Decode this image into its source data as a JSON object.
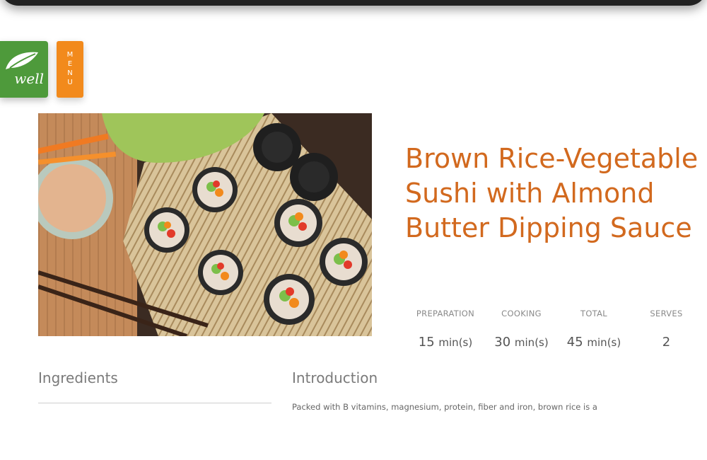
{
  "brand": {
    "logo_text": "well"
  },
  "menu": {
    "label": "MENU"
  },
  "recipe": {
    "title": "Brown Rice-Vegetable Sushi with Almond Butter Dipping Sauce",
    "stats": [
      {
        "label": "PREPARATION",
        "value": "15",
        "unit": "min(s)"
      },
      {
        "label": "COOKING",
        "value": "30",
        "unit": "min(s)"
      },
      {
        "label": "TOTAL",
        "value": "45",
        "unit": "min(s)"
      },
      {
        "label": "SERVES",
        "value": "2",
        "unit": ""
      }
    ]
  },
  "sections": {
    "ingredients_heading": "Ingredients",
    "introduction_heading": "Introduction",
    "introduction_text": "Packed with B vitamins, magnesium, protein, fiber and iron, brown rice is a"
  },
  "colors": {
    "title": "#d2691e",
    "logo_green": "#4e9a3b",
    "menu_orange": "#f28a1c"
  },
  "icons": {
    "logo": "leaf-logo-icon"
  }
}
